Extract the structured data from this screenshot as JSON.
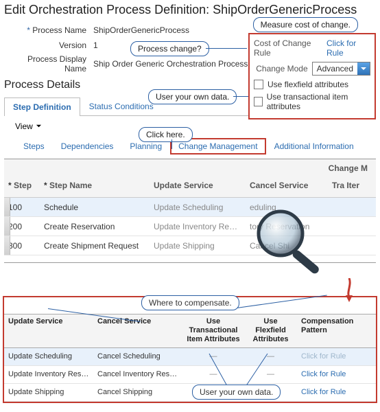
{
  "page_title": "Edit Orchestration Process Definition: ShipOrderGenericProcess",
  "form": {
    "process_name_label": "Process Name",
    "process_name_value": "ShipOrderGenericProcess",
    "version_label": "Version",
    "version_value": "1",
    "display_name_label": "Process Display Name",
    "display_name_value": "Ship Order Generic Orchestration Process"
  },
  "right": {
    "cost_label": "Cost of Change Rule",
    "cost_link": "Click for Rule",
    "mode_label": "Change Mode",
    "mode_value": "Advanced",
    "flexfield_label": "Use flexfield attributes",
    "transactional_label": "Use transactional item attributes"
  },
  "callouts": {
    "measure": "Measure cost of change.",
    "process_change": "Process change?",
    "own_data1": "User your own data.",
    "click_here": "Click here.",
    "where": "Where to compensate.",
    "own_data2": "User your own data."
  },
  "section_header": "Process Details",
  "tabs": {
    "step_def": "Step Definition",
    "status_cond": "Status Conditions"
  },
  "view_label": "View",
  "subtabs": {
    "steps": "Steps",
    "deps": "Dependencies",
    "planning": "Planning",
    "change_mgmt": "Change Management",
    "addl": "Additional Information"
  },
  "grid": {
    "cm_band": "Change M",
    "head_step": "Step",
    "head_name": "Step Name",
    "head_update": "Update Service",
    "head_cancel": "Cancel Service",
    "head_trx": "Tra\nIter",
    "rows": [
      {
        "num": "100",
        "name": "Schedule",
        "upd": "Update Scheduling",
        "can": "eduling"
      },
      {
        "num": "200",
        "name": "Create Reservation",
        "upd": "Update Inventory Reservation",
        "can": "tory Reservation"
      },
      {
        "num": "300",
        "name": "Create Shipment Request",
        "upd": "Update Shipping",
        "can": "Cancel Shi"
      }
    ]
  },
  "cm": {
    "title": "Change Management",
    "head_update": "Update Service",
    "head_cancel": "Cancel Service",
    "head_trx": "Use Transactional Item Attributes",
    "head_flex": "Use Flexfield Attributes",
    "head_comp": "Compensation Pattern",
    "rows": [
      {
        "upd": "Update Scheduling",
        "can": "Cancel Scheduling",
        "trx": "—",
        "flex": "—",
        "comp": "Click for Rule",
        "dim": true
      },
      {
        "upd": "Update Inventory Reservation",
        "can": "Cancel Inventory Reservation",
        "trx": "—",
        "flex": "—",
        "comp": "Click for Rule",
        "dim": false
      },
      {
        "upd": "Update Shipping",
        "can": "Cancel Shipping",
        "trx": "—",
        "flex": "—",
        "comp": "Click for Rule",
        "dim": false
      }
    ]
  }
}
